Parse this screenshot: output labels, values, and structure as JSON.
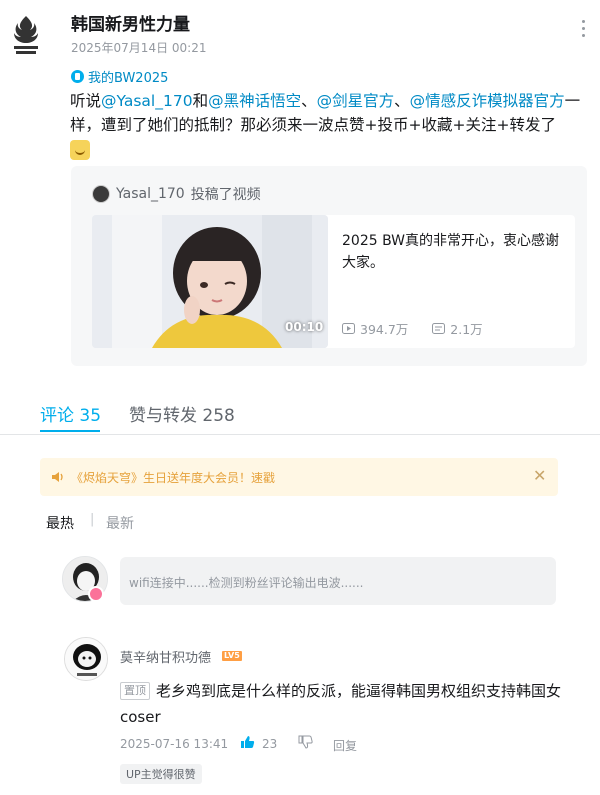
{
  "header": {
    "author": "韩国新男性力量",
    "timestamp": "2025年07月14日 00:21",
    "logo_icon": "flame-logo-icon",
    "more_icon": "more-vertical-icon"
  },
  "post": {
    "topic": "我的BW2025",
    "text_1": "听说",
    "mention_1": "@Yasal_170",
    "text_2": "和",
    "mention_2": "@黑神话悟空",
    "text_3": "、",
    "mention_3": "@剑星官方",
    "text_4": "、",
    "mention_4": "@情感反诈模拟器官方",
    "text_5": "一样，遭到了她们的抵制？那必须来一波点赞+投币+收藏+关注+转发了",
    "emoji_icon": "doge-emoji-icon"
  },
  "repost": {
    "uploader": "Yasal_170",
    "action": "投稿了视频",
    "video": {
      "duration": "00:10",
      "title": "2025 BW真的非常开心，衷心感谢大家。",
      "views": "394.7万",
      "danmaku": "2.1万"
    }
  },
  "tabs": {
    "comments": "评论 35",
    "likes_reposts": "赞与转发 258"
  },
  "notice": {
    "text": "《烬焰天穹》生日送年度大会员！速戳",
    "close": "✕"
  },
  "sort": {
    "hot": "最热",
    "separator": "|",
    "new": "最新"
  },
  "comment_input": {
    "placeholder": "wifi连接中......检测到粉丝评论输出电波......"
  },
  "comment": {
    "username": "莫辛纳甘积功德",
    "level": "LV5",
    "tag": "置顶",
    "body": "老乡鸡到底是什么样的反派，能逼得韩国男权组织支持韩国女coser",
    "time": "2025-07-16 13:41",
    "likes": "23",
    "reply": "回复",
    "up_badge": "UP主觉得很赞"
  },
  "colors": {
    "accent": "#00aeec",
    "link": "#008ac5",
    "notice_bg": "#fff7e4",
    "notice_text": "#e6a23c"
  }
}
